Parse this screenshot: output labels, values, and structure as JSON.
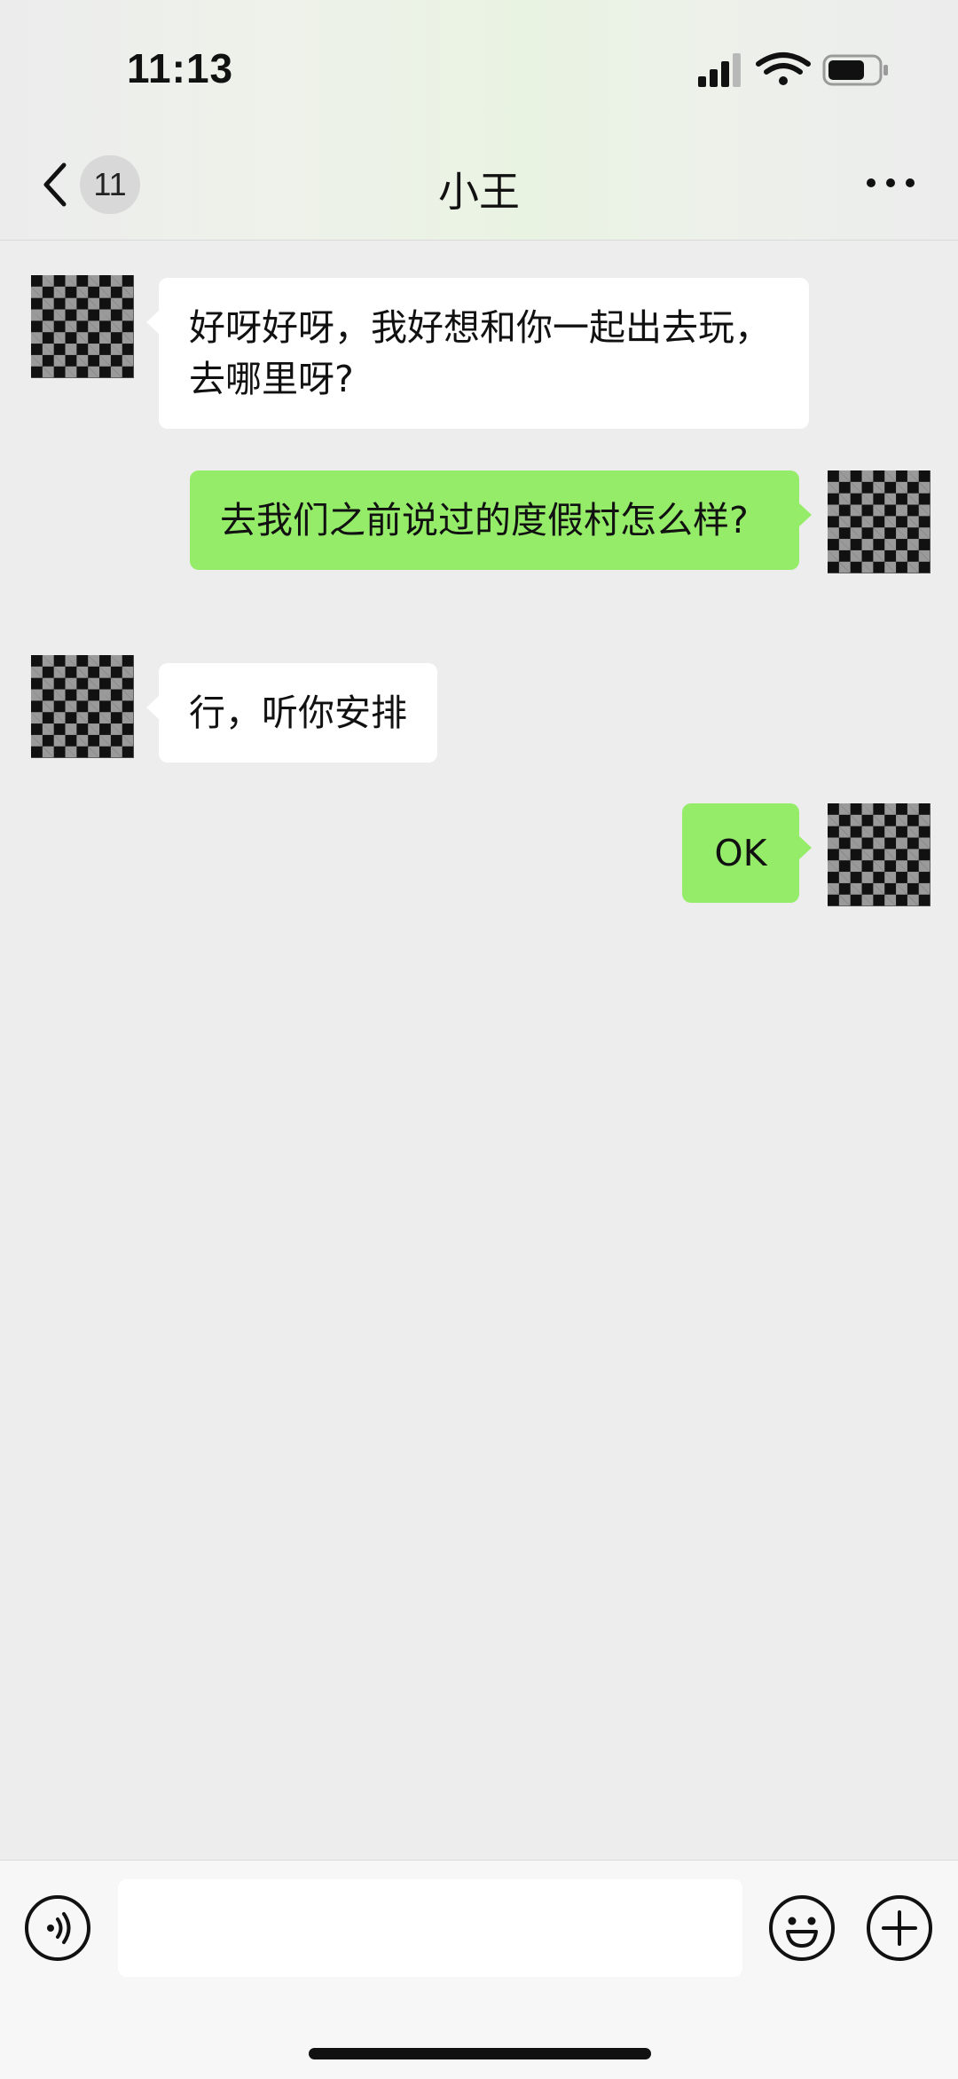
{
  "status_bar": {
    "time": "11:13",
    "icons": [
      "cellular-signal-icon",
      "wifi-icon",
      "battery-icon"
    ]
  },
  "nav": {
    "back_icon": "chevron-left-icon",
    "unread_count": "11",
    "title": "小王",
    "more_icon": "more-dots-icon"
  },
  "messages": [
    {
      "side": "received",
      "text": "好呀好呀，我好想和你一起出去玩，去哪里呀?"
    },
    {
      "side": "sent",
      "text": "去我们之前说过的度假村怎么样?"
    },
    {
      "side": "received",
      "text": "行，听你安排"
    },
    {
      "side": "sent",
      "text": "OK"
    }
  ],
  "input_bar": {
    "voice_icon": "voice-icon",
    "text_value": "",
    "emoji_icon": "emoji-icon",
    "plus_icon": "plus-icon"
  },
  "colors": {
    "background": "#ededed",
    "sent_bubble": "#95ec69",
    "received_bubble": "#ffffff"
  }
}
